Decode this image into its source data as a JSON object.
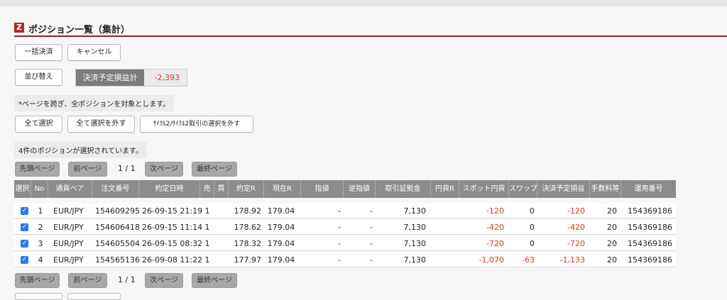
{
  "title": "ポジション一覧（集計）",
  "logo_letter": "Z",
  "buttons": {
    "bulk_settle": "一括決済",
    "cancel": "キャンセル",
    "sort": "並び替え",
    "select_all": "全て選択",
    "deselect_all": "全て選択を外す",
    "deselect_cycle": "ｻｲｸﾙ2/ｻｲｸﾙ2取引の選択を外す"
  },
  "summary": {
    "label": "決済予定損益計",
    "value": "-2,393"
  },
  "note_pages": "*ページを跨ぎ、全ポジションを対象とします。",
  "selected_note": "4件のポジションが選択されています。",
  "pager": {
    "first": "先頭ページ",
    "prev": "前ページ",
    "current": "1 / 1",
    "next": "次ページ",
    "last": "最終ページ"
  },
  "table": {
    "headers": [
      "選択",
      "No",
      "通貨ペア",
      "注文番号",
      "約定日時",
      "売",
      "買",
      "約定R",
      "現在R",
      "指値",
      "逆指値",
      "取引証拠金",
      "円貨R",
      "スポット円貨",
      "スワップ",
      "決済予定損益",
      "手数料等",
      "運用番号"
    ],
    "rows": [
      {
        "no": "1",
        "pair": "EUR/JPY",
        "order": "154609295",
        "datetime": "26-09-15 21:19",
        "sell": "1",
        "buy": "",
        "rate": "178.92",
        "current": "179.04",
        "limit": "-",
        "stop": "-",
        "margin": "7,130",
        "jpy_rate": "",
        "spot": "-120",
        "swap": "0",
        "pl": "-120",
        "fee": "20",
        "op": "154369186"
      },
      {
        "no": "2",
        "pair": "EUR/JPY",
        "order": "154606418",
        "datetime": "26-09-15 11:14",
        "sell": "1",
        "buy": "",
        "rate": "178.62",
        "current": "179.04",
        "limit": "-",
        "stop": "-",
        "margin": "7,130",
        "jpy_rate": "",
        "spot": "-420",
        "swap": "0",
        "pl": "-420",
        "fee": "20",
        "op": "154369186"
      },
      {
        "no": "3",
        "pair": "EUR/JPY",
        "order": "154605504",
        "datetime": "26-09-15 08:32",
        "sell": "1",
        "buy": "",
        "rate": "178.32",
        "current": "179.04",
        "limit": "-",
        "stop": "-",
        "margin": "7,130",
        "jpy_rate": "",
        "spot": "-720",
        "swap": "0",
        "pl": "-720",
        "fee": "20",
        "op": "154369186"
      },
      {
        "no": "4",
        "pair": "EUR/JPY",
        "order": "154565136",
        "datetime": "26-09-08 11:22",
        "sell": "1",
        "buy": "",
        "rate": "177.97",
        "current": "179.04",
        "limit": "-",
        "stop": "-",
        "margin": "7,130",
        "jpy_rate": "",
        "spot": "-1,070",
        "swap": "-63",
        "pl": "-1,133",
        "fee": "20",
        "op": "154369186"
      }
    ]
  },
  "colors": {
    "brand": "#b5271c",
    "title_rule": "#8f2a22",
    "negative": "#d23a32",
    "header_bg": "#8c8c8c",
    "checkbox": "#2f7ae0"
  }
}
